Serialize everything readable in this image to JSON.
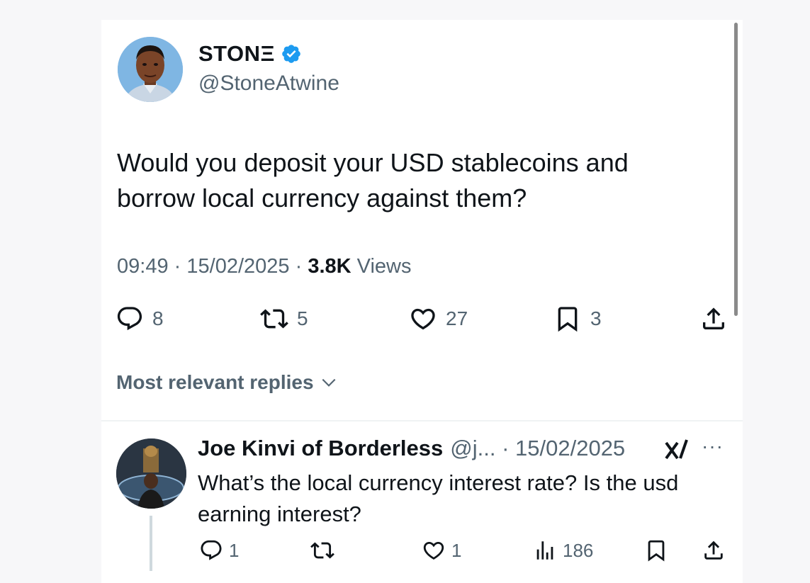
{
  "tweet": {
    "author_name": "STONΞ",
    "author_handle": "@StoneAtwine",
    "verified": true,
    "text": "Would you deposit your USD stablecoins and borrow local currency against them?",
    "time": "09:49",
    "date": "15/02/2025",
    "views_count": "3.8K",
    "views_label": "Views",
    "separator": "·",
    "actions": {
      "replies": "8",
      "reposts": "5",
      "likes": "27",
      "bookmarks": "3"
    }
  },
  "replies_filter": {
    "label": "Most relevant replies"
  },
  "reply": {
    "author_name": "Joe Kinvi of Borderless",
    "meta": "@j... · 15/02/2025",
    "more": "···",
    "text": "What’s the local currency interest rate? Is the usd earning interest?",
    "actions": {
      "replies": "1",
      "likes": "1",
      "views": "186"
    }
  },
  "colors": {
    "text_primary": "#0f1419",
    "text_secondary": "#536471",
    "verified_blue": "#1d9bf0",
    "divider": "#eff3f4",
    "background": "#f7f7f9"
  },
  "icons": [
    "verified-badge-icon",
    "reply-icon",
    "repost-icon",
    "like-icon",
    "bookmark-icon",
    "share-icon",
    "chevron-down-icon",
    "views-icon",
    "xai-logo-icon",
    "more-icon"
  ]
}
